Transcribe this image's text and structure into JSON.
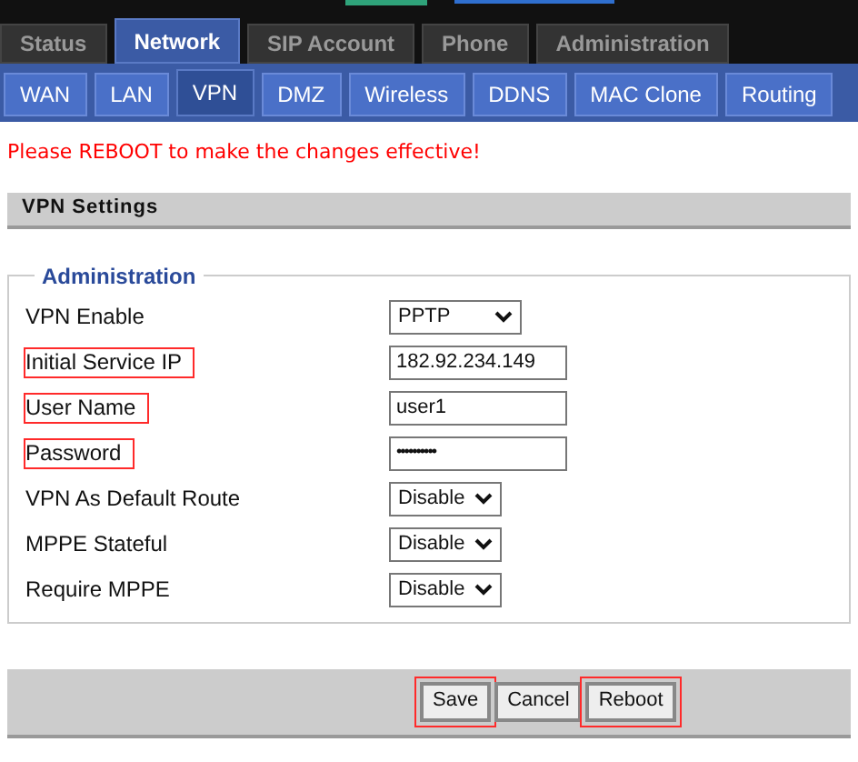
{
  "main_tabs": [
    {
      "label": "Status",
      "selected": false
    },
    {
      "label": "Network",
      "selected": true
    },
    {
      "label": "SIP Account",
      "selected": false
    },
    {
      "label": "Phone",
      "selected": false
    },
    {
      "label": "Administration",
      "selected": false
    }
  ],
  "sub_tabs": [
    {
      "label": "WAN",
      "selected": false
    },
    {
      "label": "LAN",
      "selected": false
    },
    {
      "label": "VPN",
      "selected": true
    },
    {
      "label": "DMZ",
      "selected": false
    },
    {
      "label": "Wireless",
      "selected": false
    },
    {
      "label": "DDNS",
      "selected": false
    },
    {
      "label": "MAC Clone",
      "selected": false
    },
    {
      "label": "Routing",
      "selected": false
    }
  ],
  "notice": "Please REBOOT to make the changes effective!",
  "section_title": "VPN Settings",
  "group_title": "Administration",
  "fields": [
    {
      "label": "VPN Enable",
      "kind": "select",
      "value": "PPTP",
      "highlighted": false
    },
    {
      "label": "Initial Service IP",
      "kind": "text",
      "value": "182.92.234.149",
      "highlighted": true
    },
    {
      "label": "User Name",
      "kind": "text",
      "value": "user1",
      "highlighted": true
    },
    {
      "label": "Password",
      "kind": "password",
      "value": "••••••••••",
      "highlighted": true
    },
    {
      "label": "VPN As Default Route",
      "kind": "select",
      "value": "Disable",
      "highlighted": false
    },
    {
      "label": "MPPE Stateful",
      "kind": "select",
      "value": "Disable",
      "highlighted": false
    },
    {
      "label": "Require MPPE",
      "kind": "select",
      "value": "Disable",
      "highlighted": false
    }
  ],
  "buttons": [
    {
      "label": "Save",
      "highlighted": true
    },
    {
      "label": "Cancel",
      "highlighted": false
    },
    {
      "label": "Reboot",
      "highlighted": true
    }
  ]
}
